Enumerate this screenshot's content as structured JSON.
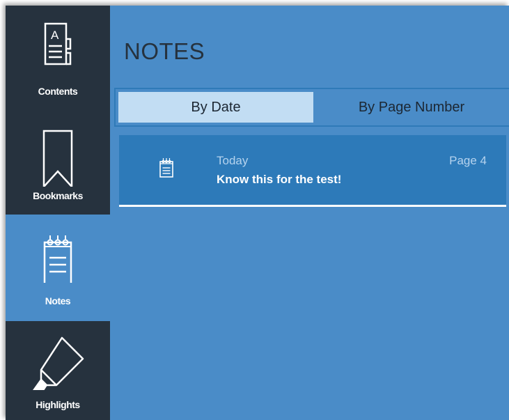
{
  "sidebar": {
    "items": [
      {
        "label": "Contents",
        "icon": "contents-icon",
        "active": false
      },
      {
        "label": "Bookmarks",
        "icon": "bookmark-icon",
        "active": false
      },
      {
        "label": "Notes",
        "icon": "notes-icon",
        "active": true
      },
      {
        "label": "Highlights",
        "icon": "highlighter-icon",
        "active": false
      }
    ]
  },
  "main": {
    "title": "NOTES",
    "tabs": [
      {
        "label": "By Date",
        "selected": true
      },
      {
        "label": "By Page Number",
        "selected": false
      }
    ],
    "notes": [
      {
        "date": "Today",
        "text": "Know this for the test!",
        "page": "Page 4",
        "icon": "notepad-icon"
      }
    ]
  },
  "colors": {
    "background": "#4a8cc8",
    "sidebar": "#26323e",
    "selected_tab": "#c2ddf3",
    "note_row": "#2d7ab9",
    "title_text": "#26323e"
  }
}
